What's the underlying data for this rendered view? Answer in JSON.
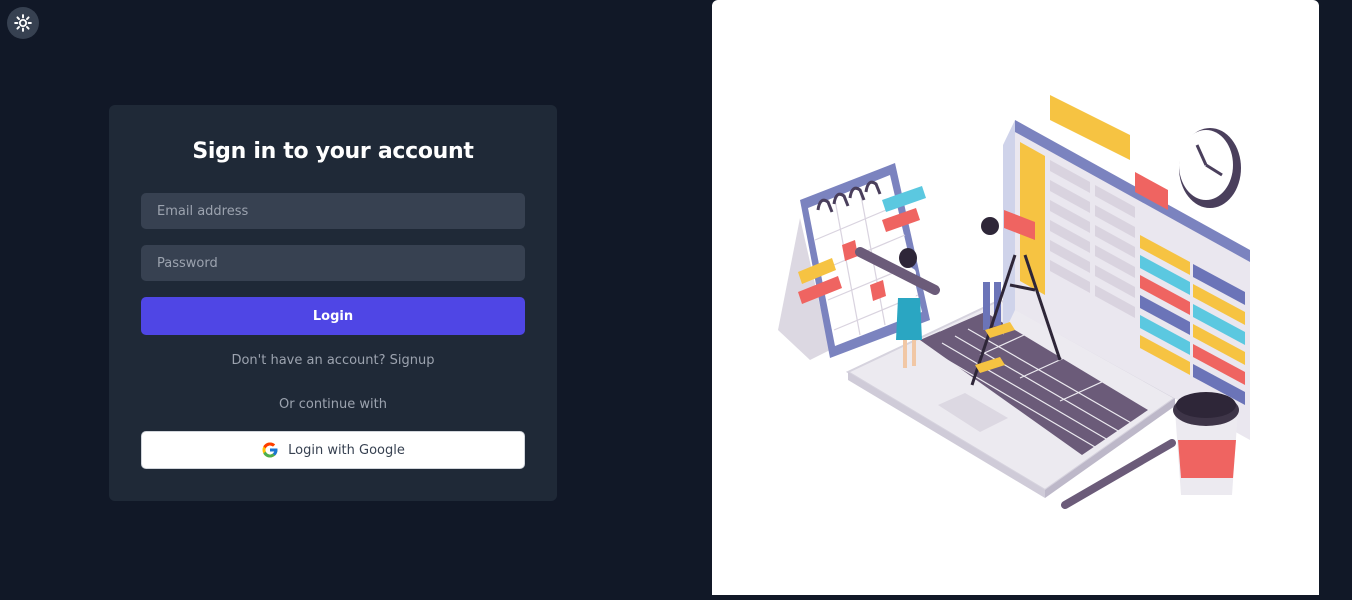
{
  "theme_toggle": {
    "icon": "sun-icon"
  },
  "login_form": {
    "title": "Sign in to your account",
    "email_placeholder": "Email address",
    "email_value": "",
    "password_placeholder": "Password",
    "password_value": "",
    "login_label": "Login",
    "signup_prompt": "Don't have an account?",
    "signup_link": "Signup",
    "continue_with": "Or continue with",
    "google_label": "Login with Google",
    "google_icon": "google-logo-icon"
  },
  "illustration": {
    "description_icon": "isometric-calendar-spreadsheet-illustration"
  },
  "colors": {
    "page_bg": "#111827",
    "card_bg": "#1f2937",
    "input_bg": "#374151",
    "primary": "#4f46e5",
    "google_bg": "#ffffff"
  }
}
